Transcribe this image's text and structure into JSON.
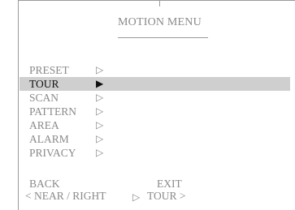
{
  "title": "MOTION MENU",
  "menu": {
    "items": [
      {
        "label": "PRESET",
        "arrow": "▷"
      },
      {
        "label": "TOUR",
        "arrow": "▶"
      },
      {
        "label": "SCAN",
        "arrow": "▷"
      },
      {
        "label": "PATTERN",
        "arrow": "▷"
      },
      {
        "label": "AREA",
        "arrow": "▷"
      },
      {
        "label": "ALARM",
        "arrow": "▷"
      },
      {
        "label": "PRIVACY",
        "arrow": "▷"
      }
    ],
    "selected": "TOUR"
  },
  "footer": {
    "back": "BACK",
    "exit": "EXIT",
    "nav_left": "< NEAR / RIGHT",
    "nav_arrow": "▷",
    "nav_right": "TOUR >"
  }
}
